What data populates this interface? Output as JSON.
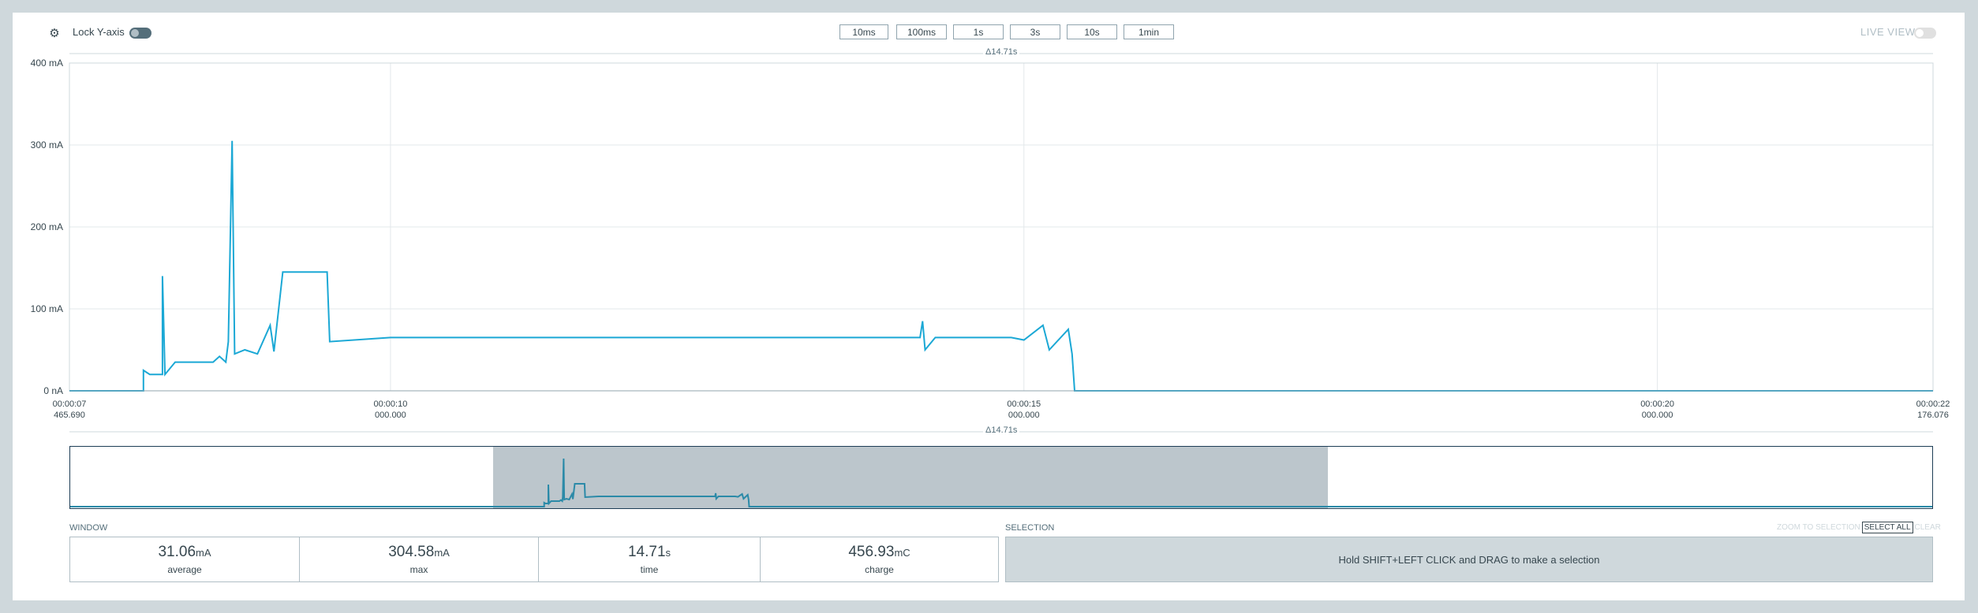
{
  "topbar": {
    "lock_label": "Lock Y-axis",
    "zoom_buttons": [
      "10ms",
      "100ms",
      "1s",
      "3s",
      "10s",
      "1min"
    ],
    "live_view_label": "LIVE VIEW"
  },
  "chart": {
    "delta_label": "Δ14.71s",
    "y_ticks": [
      "400 mA",
      "300 mA",
      "200 mA",
      "100 mA",
      "0 nA"
    ],
    "x_ticks": [
      {
        "time": "00:00:07",
        "sub": "465.690"
      },
      {
        "time": "00:00:10",
        "sub": "000.000"
      },
      {
        "time": "00:00:15",
        "sub": "000.000"
      },
      {
        "time": "00:00:20",
        "sub": "000.000"
      },
      {
        "time": "00:00:22",
        "sub": "176.076"
      }
    ]
  },
  "chart_data": {
    "type": "line",
    "title": "",
    "xlabel": "",
    "ylabel": "",
    "ylim": [
      0,
      400
    ],
    "x_unit": "s",
    "y_unit": "mA",
    "grid": true,
    "series": [
      {
        "values": [
          [
            7.4657,
            0
          ],
          [
            8.05,
            0
          ],
          [
            8.05,
            25
          ],
          [
            8.1,
            20
          ],
          [
            8.2,
            20
          ],
          [
            8.2,
            140
          ],
          [
            8.22,
            20
          ],
          [
            8.3,
            35
          ],
          [
            8.6,
            35
          ],
          [
            8.65,
            42
          ],
          [
            8.7,
            35
          ],
          [
            8.72,
            60
          ],
          [
            8.75,
            305
          ],
          [
            8.77,
            45
          ],
          [
            8.85,
            50
          ],
          [
            8.95,
            45
          ],
          [
            9.05,
            80
          ],
          [
            9.08,
            48
          ],
          [
            9.15,
            145
          ],
          [
            9.5,
            145
          ],
          [
            9.52,
            60
          ],
          [
            10.0,
            65
          ],
          [
            11.0,
            65
          ],
          [
            12.0,
            65
          ],
          [
            13.0,
            65
          ],
          [
            14.18,
            65
          ],
          [
            14.2,
            85
          ],
          [
            14.22,
            50
          ],
          [
            14.3,
            65
          ],
          [
            14.9,
            65
          ],
          [
            15.0,
            62
          ],
          [
            15.15,
            80
          ],
          [
            15.2,
            50
          ],
          [
            15.35,
            75
          ],
          [
            15.38,
            45
          ],
          [
            15.4,
            0
          ],
          [
            22.176,
            0
          ]
        ],
        "color": "#1ba8d5"
      }
    ]
  },
  "minimap": {
    "delta_label": "Δ14.71s"
  },
  "window_section": {
    "label": "WINDOW",
    "stats": [
      {
        "value": "31.06",
        "unit": "mA",
        "caption": "average"
      },
      {
        "value": "304.58",
        "unit": "mA",
        "caption": "max"
      },
      {
        "value": "14.71",
        "unit": "s",
        "caption": "time"
      },
      {
        "value": "456.93",
        "unit": "mC",
        "caption": "charge"
      }
    ]
  },
  "selection_section": {
    "label": "SELECTION",
    "zoom_to_selection": "ZOOM TO SELECTION",
    "select_all": "SELECT ALL",
    "clear": "CLEAR",
    "hint": "Hold SHIFT+LEFT CLICK and DRAG to make a selection"
  },
  "colors": {
    "trace": "#1ba8d5",
    "minimap_trace": "#2b8aa8",
    "background": "#cfd8dc"
  }
}
